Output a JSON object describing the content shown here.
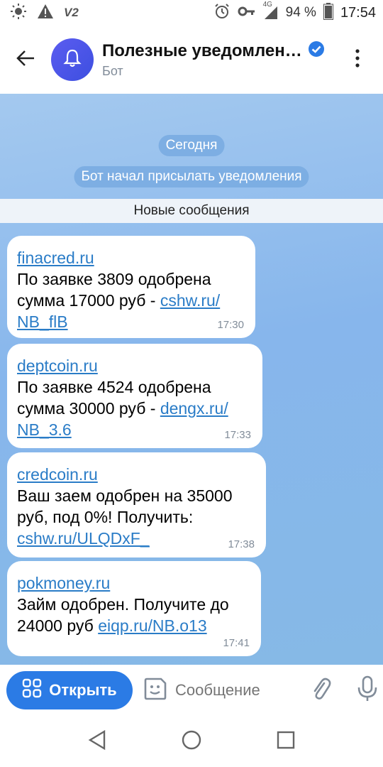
{
  "status_bar": {
    "carrier_tag": "V2",
    "network": "4G",
    "battery": "94 %",
    "time": "17:54"
  },
  "header": {
    "title": "Полезные уведомлен…",
    "subtitle": "Бот",
    "verified_icon": "verified-badge-icon"
  },
  "chat": {
    "date_pill": "Сегодня",
    "service_pill": "Бот начал присылать уведомления",
    "new_messages": "Новые сообщения",
    "messages": [
      {
        "link": "finacred.ru",
        "line1": "По заявке 3809 одобрена",
        "line2_text": "сумма 17000 руб - ",
        "line2_link": "cshw.ru/",
        "line3_link": "NB_flB",
        "time": "17:30"
      },
      {
        "link": "deptcoin.ru",
        "line1": "По заявке 4524 одобрена",
        "line2_text": "сумма 30000 руб - ",
        "line2_link": "dengx.ru/",
        "line3_link": "NB_3.6",
        "time": "17:33"
      },
      {
        "link": "credcoin.ru",
        "line1": "Ваш заем одобрен на 35000",
        "line2_text": "руб, под 0%! Получить:",
        "line3_link": "cshw.ru/ULQDxF_",
        "time": "17:38"
      },
      {
        "link": "pokmoney.ru",
        "line1": "Займ одобрен. Получите до",
        "line2_text": "24000 руб ",
        "line2_link": "eiqp.ru/NB.o13",
        "time": "17:41"
      }
    ]
  },
  "input_bar": {
    "open_label": "Открыть",
    "placeholder": "Сообщение"
  },
  "colors": {
    "accent": "#2b7be5",
    "link": "#2a7cc7",
    "chat_bg": "#87b6ec"
  }
}
